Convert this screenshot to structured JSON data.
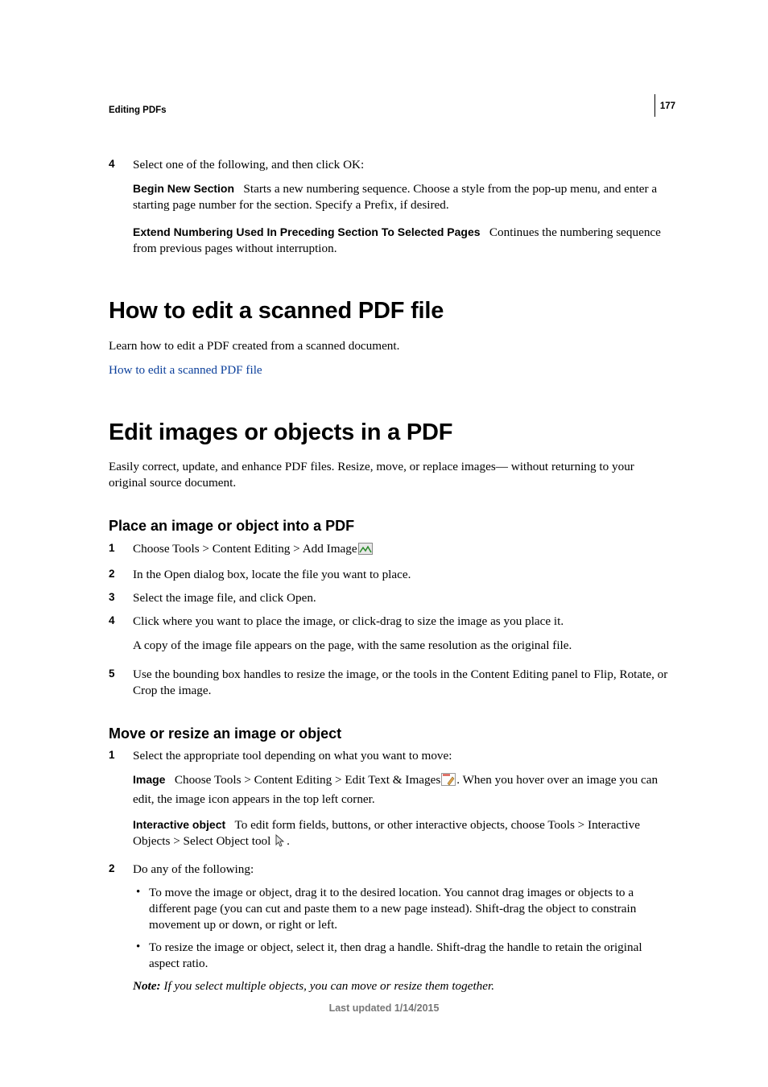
{
  "page_number": "177",
  "header": "Editing PDFs",
  "footer": "Last updated 1/14/2015",
  "top_item": {
    "num": "4",
    "text": "Select one of the following, and then click OK:",
    "opt1_term": "Begin New Section",
    "opt1_text": "Starts a new numbering sequence. Choose a style from the pop-up menu, and enter a starting page number for the section. Specify a Prefix, if desired.",
    "opt2_term": "Extend Numbering Used In Preceding Section To Selected Pages",
    "opt2_text": "Continues the numbering sequence from previous pages without interruption."
  },
  "scanned": {
    "title": "How to edit a scanned PDF file",
    "intro": "Learn how to edit a PDF created from a scanned document.",
    "link": "How to edit a scanned PDF file"
  },
  "edit": {
    "title": "Edit images or objects in a PDF",
    "intro": "Easily correct, update, and enhance PDF files. Resize, move, or replace images— without returning to your original source document."
  },
  "place": {
    "title": "Place an image or object into a PDF",
    "s1": {
      "num": "1",
      "text": "Choose Tools > Content Editing > Add Image"
    },
    "s2": {
      "num": "2",
      "text": "In the Open dialog box, locate the file you want to place."
    },
    "s3": {
      "num": "3",
      "text": "Select the image file, and click Open."
    },
    "s4": {
      "num": "4",
      "text": "Click where you want to place the image, or click-drag to size the image as you place it.",
      "p2": "A copy of the image file appears on the page, with the same resolution as the original file."
    },
    "s5": {
      "num": "5",
      "text": "Use the bounding box handles to resize the image, or the tools in the Content Editing panel to Flip, Rotate, or Crop the image."
    }
  },
  "move": {
    "title": "Move or resize an image or object",
    "s1": {
      "num": "1",
      "text": "Select the appropriate tool depending on what you want to move:",
      "image_term": "Image",
      "image_text_a": "Choose Tools > Content Editing > Edit Text & Images",
      "image_text_b": ". When you hover over an image you can edit, the image icon appears in the top left corner.",
      "inter_term": "Interactive object",
      "inter_text_a": "To edit form fields, buttons, or other interactive objects, choose Tools > Interactive Objects > Select Object tool",
      "inter_text_b": "."
    },
    "s2": {
      "num": "2",
      "text": "Do any of the following:",
      "b1": "To move the image or object, drag it to the desired location. You cannot drag images or objects to a different page (you can cut and paste them to a new page instead). Shift-drag the object to constrain movement up or down, or right or left.",
      "b2": "To resize the image or object, select it, then drag a handle. Shift-drag the handle to retain the original aspect ratio."
    },
    "note_label": "Note:",
    "note_text": "If you select multiple objects, you can move or resize them together."
  }
}
